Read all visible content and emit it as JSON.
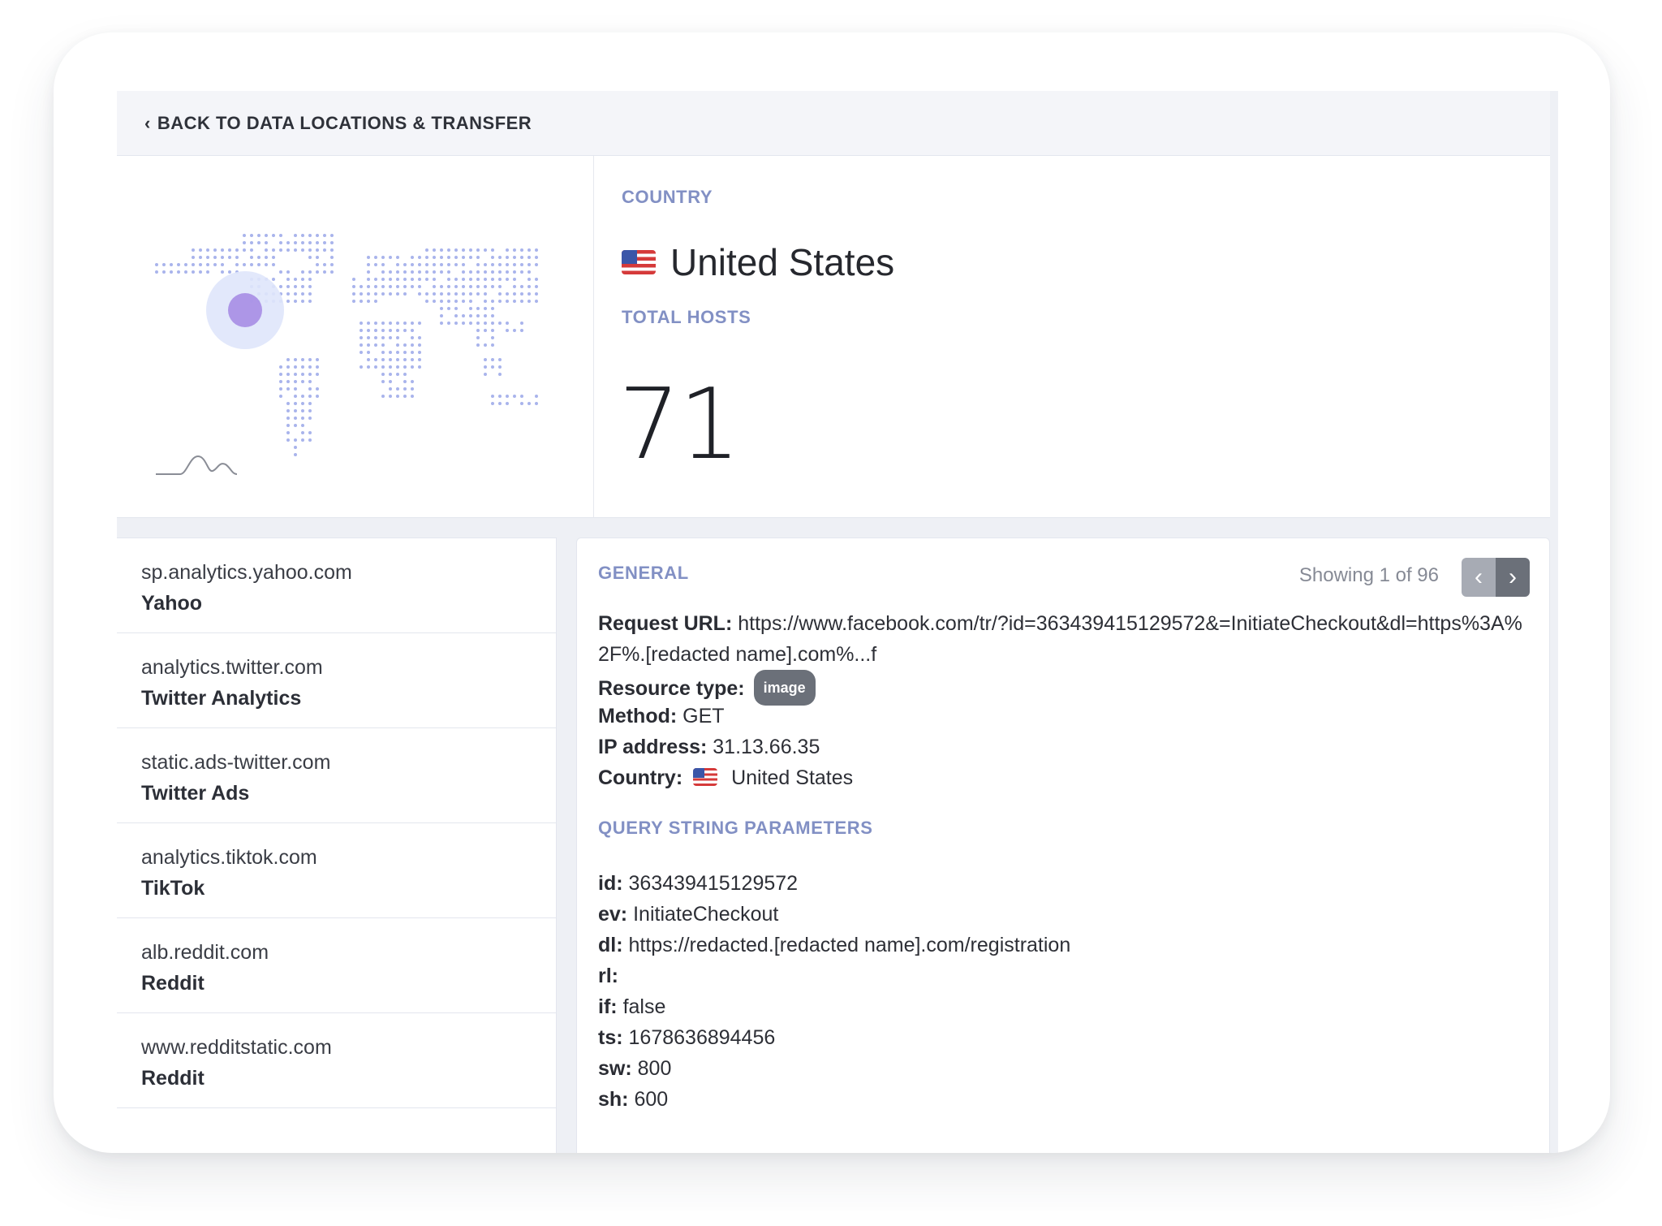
{
  "nav": {
    "back_label": "BACK TO DATA LOCATIONS & TRANSFER"
  },
  "summary": {
    "country_label": "COUNTRY",
    "country_value": "United States",
    "hosts_label": "TOTAL HOSTS",
    "hosts_value": "71"
  },
  "hosts": [
    {
      "domain": "sp.analytics.yahoo.com",
      "name": "Yahoo"
    },
    {
      "domain": "analytics.twitter.com",
      "name": "Twitter Analytics"
    },
    {
      "domain": "static.ads-twitter.com",
      "name": "Twitter Ads"
    },
    {
      "domain": "analytics.tiktok.com",
      "name": "TikTok"
    },
    {
      "domain": "alb.reddit.com",
      "name": "Reddit"
    },
    {
      "domain": "www.redditstatic.com",
      "name": "Reddit"
    }
  ],
  "details": {
    "general_label": "GENERAL",
    "showing": "Showing 1 of 96",
    "request_url_label": "Request URL:",
    "request_url": "https://www.facebook.com/tr/?id=363439415129572&=InitiateCheckout&dl=https%3A%2F%.[redacted name].com%...f",
    "resource_type_label": "Resource type:",
    "resource_type": "image",
    "method_label": "Method:",
    "method": "GET",
    "ip_label": "IP address:",
    "ip": "31.13.66.35",
    "country_label": "Country:",
    "country": "United States",
    "qs_label": "QUERY STRING PARAMETERS",
    "params": [
      {
        "key": "id:",
        "value": "363439415129572"
      },
      {
        "key": "ev:",
        "value": "InitiateCheckout"
      },
      {
        "key": "dl:",
        "value": "https://redacted.[redacted name].com/registration"
      },
      {
        "key": "rl:",
        "value": ""
      },
      {
        "key": "if:",
        "value": "false"
      },
      {
        "key": "ts:",
        "value": "1678636894456"
      },
      {
        "key": "sw:",
        "value": "800"
      },
      {
        "key": "sh:",
        "value": "600"
      }
    ]
  },
  "colors": {
    "accent_label": "#8290c4",
    "map_dot": "#a9b4ec",
    "highlight": "#9b7be0"
  }
}
